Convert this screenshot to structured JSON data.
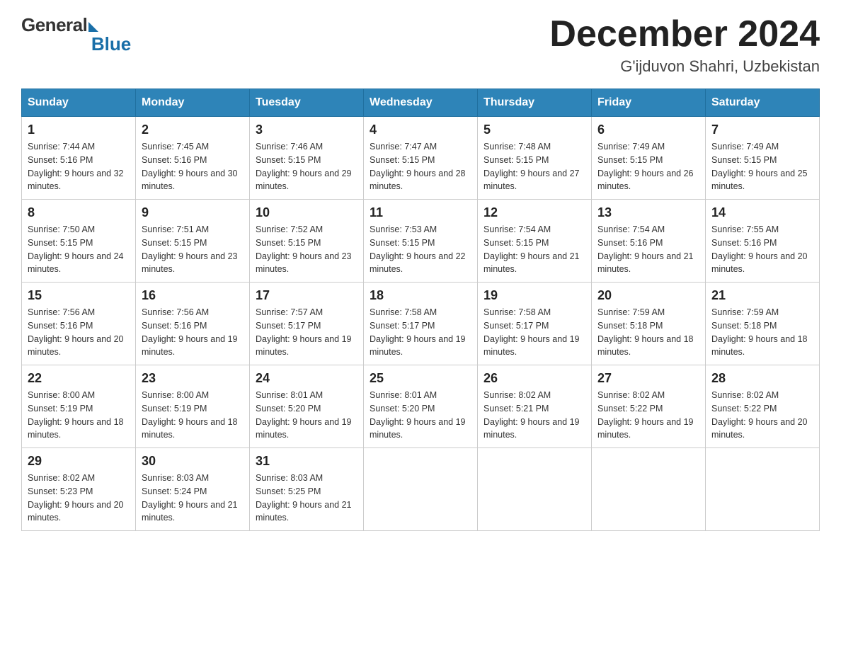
{
  "header": {
    "logo_general": "General",
    "logo_blue": "Blue",
    "title": "December 2024",
    "location": "G'ijduvon Shahri, Uzbekistan"
  },
  "days_of_week": [
    "Sunday",
    "Monday",
    "Tuesday",
    "Wednesday",
    "Thursday",
    "Friday",
    "Saturday"
  ],
  "weeks": [
    [
      {
        "day": "1",
        "sunrise": "7:44 AM",
        "sunset": "5:16 PM",
        "daylight": "9 hours and 32 minutes."
      },
      {
        "day": "2",
        "sunrise": "7:45 AM",
        "sunset": "5:16 PM",
        "daylight": "9 hours and 30 minutes."
      },
      {
        "day": "3",
        "sunrise": "7:46 AM",
        "sunset": "5:15 PM",
        "daylight": "9 hours and 29 minutes."
      },
      {
        "day": "4",
        "sunrise": "7:47 AM",
        "sunset": "5:15 PM",
        "daylight": "9 hours and 28 minutes."
      },
      {
        "day": "5",
        "sunrise": "7:48 AM",
        "sunset": "5:15 PM",
        "daylight": "9 hours and 27 minutes."
      },
      {
        "day": "6",
        "sunrise": "7:49 AM",
        "sunset": "5:15 PM",
        "daylight": "9 hours and 26 minutes."
      },
      {
        "day": "7",
        "sunrise": "7:49 AM",
        "sunset": "5:15 PM",
        "daylight": "9 hours and 25 minutes."
      }
    ],
    [
      {
        "day": "8",
        "sunrise": "7:50 AM",
        "sunset": "5:15 PM",
        "daylight": "9 hours and 24 minutes."
      },
      {
        "day": "9",
        "sunrise": "7:51 AM",
        "sunset": "5:15 PM",
        "daylight": "9 hours and 23 minutes."
      },
      {
        "day": "10",
        "sunrise": "7:52 AM",
        "sunset": "5:15 PM",
        "daylight": "9 hours and 23 minutes."
      },
      {
        "day": "11",
        "sunrise": "7:53 AM",
        "sunset": "5:15 PM",
        "daylight": "9 hours and 22 minutes."
      },
      {
        "day": "12",
        "sunrise": "7:54 AM",
        "sunset": "5:15 PM",
        "daylight": "9 hours and 21 minutes."
      },
      {
        "day": "13",
        "sunrise": "7:54 AM",
        "sunset": "5:16 PM",
        "daylight": "9 hours and 21 minutes."
      },
      {
        "day": "14",
        "sunrise": "7:55 AM",
        "sunset": "5:16 PM",
        "daylight": "9 hours and 20 minutes."
      }
    ],
    [
      {
        "day": "15",
        "sunrise": "7:56 AM",
        "sunset": "5:16 PM",
        "daylight": "9 hours and 20 minutes."
      },
      {
        "day": "16",
        "sunrise": "7:56 AM",
        "sunset": "5:16 PM",
        "daylight": "9 hours and 19 minutes."
      },
      {
        "day": "17",
        "sunrise": "7:57 AM",
        "sunset": "5:17 PM",
        "daylight": "9 hours and 19 minutes."
      },
      {
        "day": "18",
        "sunrise": "7:58 AM",
        "sunset": "5:17 PM",
        "daylight": "9 hours and 19 minutes."
      },
      {
        "day": "19",
        "sunrise": "7:58 AM",
        "sunset": "5:17 PM",
        "daylight": "9 hours and 19 minutes."
      },
      {
        "day": "20",
        "sunrise": "7:59 AM",
        "sunset": "5:18 PM",
        "daylight": "9 hours and 18 minutes."
      },
      {
        "day": "21",
        "sunrise": "7:59 AM",
        "sunset": "5:18 PM",
        "daylight": "9 hours and 18 minutes."
      }
    ],
    [
      {
        "day": "22",
        "sunrise": "8:00 AM",
        "sunset": "5:19 PM",
        "daylight": "9 hours and 18 minutes."
      },
      {
        "day": "23",
        "sunrise": "8:00 AM",
        "sunset": "5:19 PM",
        "daylight": "9 hours and 18 minutes."
      },
      {
        "day": "24",
        "sunrise": "8:01 AM",
        "sunset": "5:20 PM",
        "daylight": "9 hours and 19 minutes."
      },
      {
        "day": "25",
        "sunrise": "8:01 AM",
        "sunset": "5:20 PM",
        "daylight": "9 hours and 19 minutes."
      },
      {
        "day": "26",
        "sunrise": "8:02 AM",
        "sunset": "5:21 PM",
        "daylight": "9 hours and 19 minutes."
      },
      {
        "day": "27",
        "sunrise": "8:02 AM",
        "sunset": "5:22 PM",
        "daylight": "9 hours and 19 minutes."
      },
      {
        "day": "28",
        "sunrise": "8:02 AM",
        "sunset": "5:22 PM",
        "daylight": "9 hours and 20 minutes."
      }
    ],
    [
      {
        "day": "29",
        "sunrise": "8:02 AM",
        "sunset": "5:23 PM",
        "daylight": "9 hours and 20 minutes."
      },
      {
        "day": "30",
        "sunrise": "8:03 AM",
        "sunset": "5:24 PM",
        "daylight": "9 hours and 21 minutes."
      },
      {
        "day": "31",
        "sunrise": "8:03 AM",
        "sunset": "5:25 PM",
        "daylight": "9 hours and 21 minutes."
      },
      null,
      null,
      null,
      null
    ]
  ]
}
